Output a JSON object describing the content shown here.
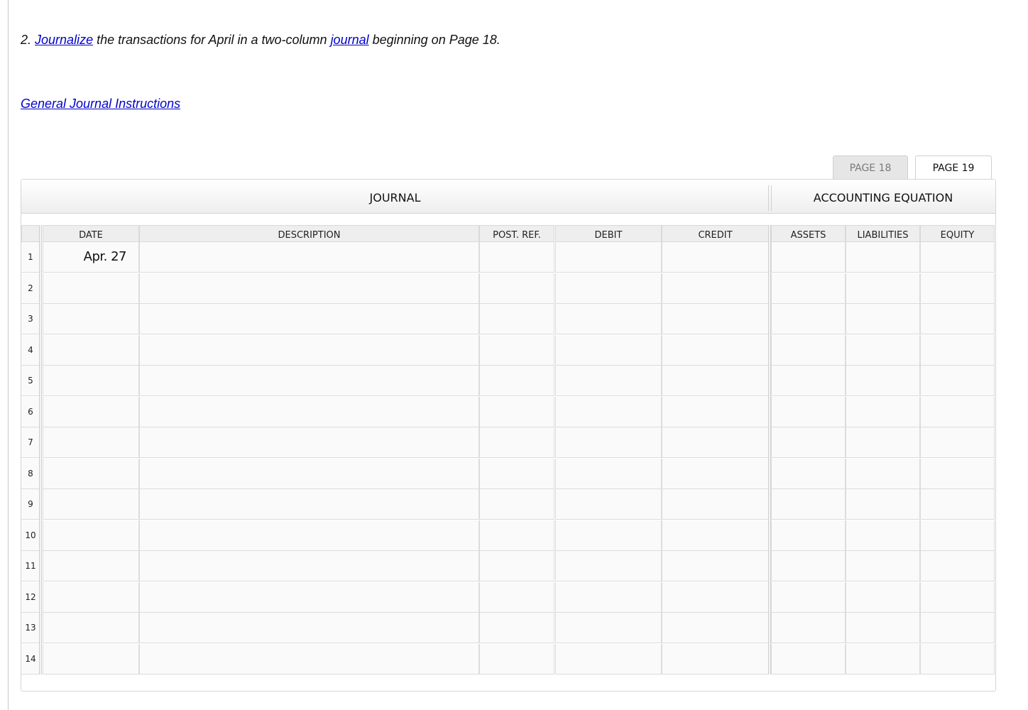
{
  "instruction": {
    "number": "2.",
    "word1": "Journalize",
    "text1": " the transactions for April in a two-column ",
    "word2": "journal",
    "text2": " beginning on Page 18."
  },
  "instructions_link": "General Journal Instructions",
  "tabs": [
    {
      "label": "PAGE 18",
      "active": false
    },
    {
      "label": "PAGE 19",
      "active": true
    }
  ],
  "headers": {
    "journal": "JOURNAL",
    "equation": "ACCOUNTING EQUATION"
  },
  "columns": {
    "date": "DATE",
    "description": "DESCRIPTION",
    "post_ref": "POST. REF.",
    "debit": "DEBIT",
    "credit": "CREDIT",
    "assets": "ASSETS",
    "liabilities": "LIABILITIES",
    "equity": "EQUITY"
  },
  "rows": [
    {
      "num": "1",
      "date": "Apr. 27"
    },
    {
      "num": "2",
      "date": ""
    },
    {
      "num": "3",
      "date": ""
    },
    {
      "num": "4",
      "date": ""
    },
    {
      "num": "5",
      "date": ""
    },
    {
      "num": "6",
      "date": ""
    },
    {
      "num": "7",
      "date": ""
    },
    {
      "num": "8",
      "date": ""
    },
    {
      "num": "9",
      "date": ""
    },
    {
      "num": "10",
      "date": ""
    },
    {
      "num": "11",
      "date": ""
    },
    {
      "num": "12",
      "date": ""
    },
    {
      "num": "13",
      "date": ""
    },
    {
      "num": "14",
      "date": ""
    }
  ]
}
